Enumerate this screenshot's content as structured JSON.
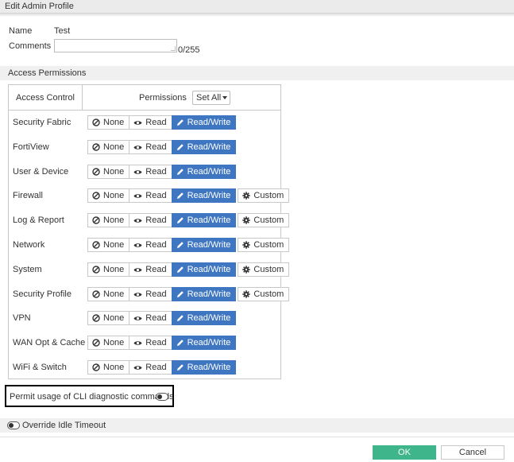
{
  "window": {
    "title": "Edit Admin Profile"
  },
  "form": {
    "name_label": "Name",
    "name_value": "Test",
    "comments_label": "Comments",
    "comments_value": "",
    "comments_counter": "0/255"
  },
  "access": {
    "section_title": "Access Permissions",
    "col_access_control": "Access Control",
    "col_permissions": "Permissions",
    "set_all_label": "Set All",
    "btn_none": "None",
    "btn_read": "Read",
    "btn_readwrite": "Read/Write",
    "btn_custom": "Custom",
    "rows": [
      {
        "label": "Security Fabric",
        "selected": "Read/Write",
        "has_custom": false
      },
      {
        "label": "FortiView",
        "selected": "Read/Write",
        "has_custom": false
      },
      {
        "label": "User & Device",
        "selected": "Read/Write",
        "has_custom": false
      },
      {
        "label": "Firewall",
        "selected": "Read/Write",
        "has_custom": true
      },
      {
        "label": "Log & Report",
        "selected": "Read/Write",
        "has_custom": true
      },
      {
        "label": "Network",
        "selected": "Read/Write",
        "has_custom": true
      },
      {
        "label": "System",
        "selected": "Read/Write",
        "has_custom": true
      },
      {
        "label": "Security Profile",
        "selected": "Read/Write",
        "has_custom": true
      },
      {
        "label": "VPN",
        "selected": "Read/Write",
        "has_custom": false
      },
      {
        "label": "WAN Opt & Cache",
        "selected": "Read/Write",
        "has_custom": false
      },
      {
        "label": "WiFi & Switch",
        "selected": "Read/Write",
        "has_custom": false
      }
    ]
  },
  "cli": {
    "label": "Permit usage of CLI diagnostic commands",
    "enabled": false
  },
  "override": {
    "label": "Override Idle Timeout",
    "enabled": false
  },
  "footer": {
    "ok_label": "OK",
    "cancel_label": "Cancel"
  },
  "colors": {
    "active": "#3f76c1",
    "ok": "#3fb58b",
    "section_bg": "#f0f0f0"
  },
  "icons": {
    "none": "ban-icon",
    "read": "eye-icon",
    "readwrite": "pencil-icon",
    "custom": "gear-icon"
  }
}
